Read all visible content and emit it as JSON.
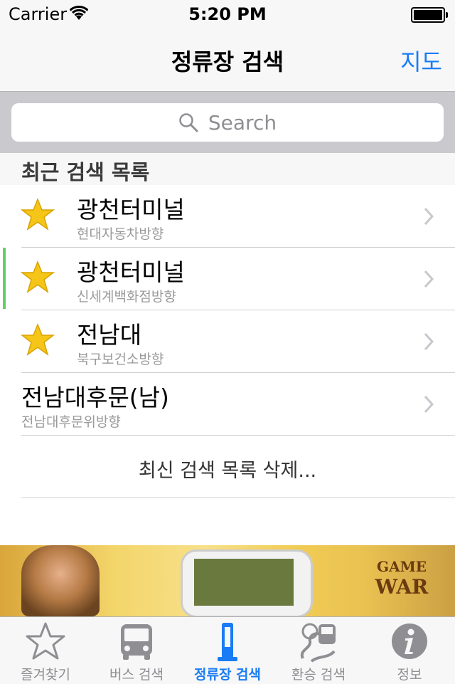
{
  "status_bar": {
    "carrier": "Carrier",
    "time": "5:20 PM"
  },
  "nav": {
    "title": "정류장 검색",
    "right_button": "지도"
  },
  "search": {
    "placeholder": "Search"
  },
  "section": {
    "title": "최근 검색 목록"
  },
  "recent": [
    {
      "title": "광천터미널",
      "subtitle": "현대자동차방향",
      "starred": true
    },
    {
      "title": "광천터미널",
      "subtitle": "신세계백화점방향",
      "starred": true
    },
    {
      "title": "전남대",
      "subtitle": "북구보건소방향",
      "starred": true
    },
    {
      "title": "전남대후문(남)",
      "subtitle": "전남대후문위방향",
      "starred": false
    }
  ],
  "delete_action": "최신 검색 목록 삭제...",
  "ad": {
    "brand_line1": "GAME",
    "brand_line2": "WAR"
  },
  "tabs": [
    {
      "label": "즐겨찾기",
      "icon": "star-outline-icon",
      "active": false
    },
    {
      "label": "버스 검색",
      "icon": "bus-icon",
      "active": false
    },
    {
      "label": "정류장 검색",
      "icon": "bus-stop-icon",
      "active": true
    },
    {
      "label": "환승 검색",
      "icon": "transfer-icon",
      "active": false
    },
    {
      "label": "정보",
      "icon": "info-icon",
      "active": false
    }
  ],
  "colors": {
    "accent": "#1a7cf5",
    "star": "#f5c518",
    "inactive": "#8e8e93"
  }
}
